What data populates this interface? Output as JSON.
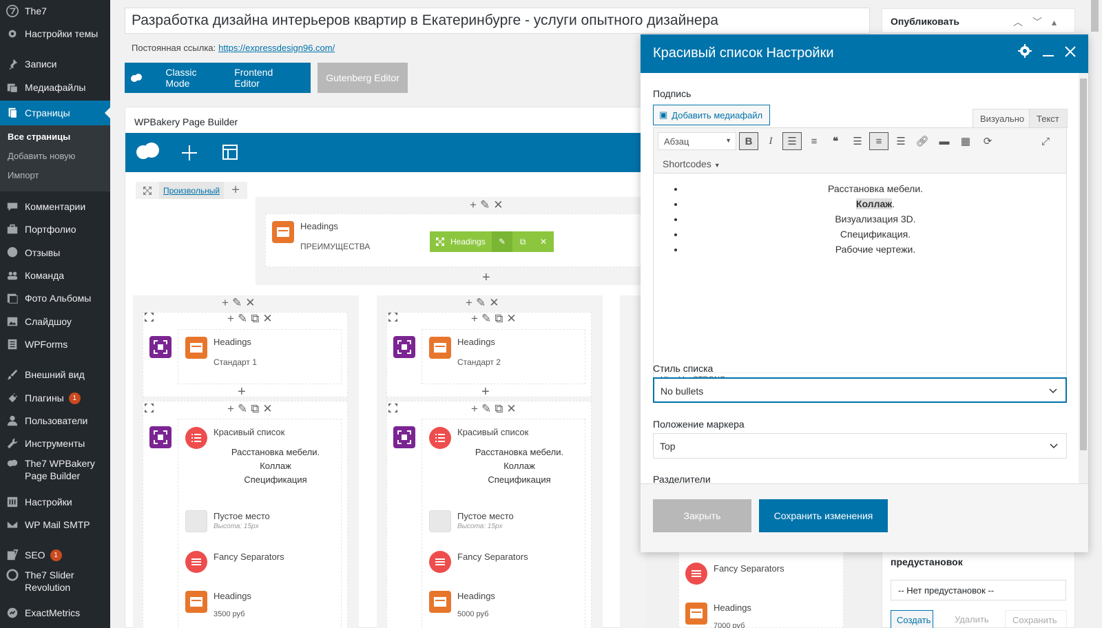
{
  "sidebar": {
    "items": [
      {
        "label": "The7",
        "icon": "the7-icon"
      },
      {
        "label": "Настройки темы",
        "icon": "gear-icon"
      },
      {
        "label": "Записи",
        "icon": "pin-icon"
      },
      {
        "label": "Медиафайлы",
        "icon": "media-icon"
      },
      {
        "label": "Страницы",
        "icon": "pages-icon"
      },
      {
        "label": "Комментарии",
        "icon": "comment-icon"
      },
      {
        "label": "Портфолио",
        "icon": "portfolio-icon"
      },
      {
        "label": "Отзывы",
        "icon": "testimonial-icon"
      },
      {
        "label": "Команда",
        "icon": "team-icon"
      },
      {
        "label": "Фото Альбомы",
        "icon": "album-icon"
      },
      {
        "label": "Слайдшоу",
        "icon": "slideshow-icon"
      },
      {
        "label": "WPForms",
        "icon": "forms-icon"
      },
      {
        "label": "Внешний вид",
        "icon": "brush-icon"
      },
      {
        "label": "Плагины",
        "icon": "plugin-icon",
        "badge": "1"
      },
      {
        "label": "Пользователи",
        "icon": "user-icon"
      },
      {
        "label": "Инструменты",
        "icon": "wrench-icon"
      },
      {
        "label": "The7 WPBakery",
        "label2": "Page Builder",
        "icon": "cloud-icon"
      },
      {
        "label": "Настройки",
        "icon": "settings-icon"
      },
      {
        "label": "WP Mail SMTP",
        "icon": "mail-icon"
      },
      {
        "label": "SEO",
        "icon": "yoast-icon",
        "badge": "1"
      },
      {
        "label": "The7 Slider",
        "label2": "Revolution",
        "icon": "slider-icon"
      },
      {
        "label": "ExactMetrics",
        "icon": "metrics-icon"
      }
    ],
    "submenu": [
      "Все страницы",
      "Добавить новую",
      "Импорт"
    ]
  },
  "editor": {
    "title": "Разработка дизайна интерьеров квартир в Екатеринбурге - услуги опытного дизайнера",
    "permalink_label": "Постоянная ссылка:",
    "permalink_url": "https://expressdesign96.com/",
    "modes": [
      "Classic Mode",
      "Frontend Editor"
    ],
    "gutenberg": "Gutenberg Editor"
  },
  "wpb": {
    "header": "WPBakery Page Builder",
    "row_label": "Произвольный",
    "top_element": {
      "title": "Headings",
      "sub": "ПРЕИМУЩЕСТВА"
    },
    "green_bar_label": "Headings",
    "columns": [
      {
        "heading_title": "Headings",
        "heading_sub": "Стандарт 1",
        "list_title": "Красивый список",
        "list_items": [
          "Расстановка мебели.",
          "Коллаж",
          "Спецификация"
        ],
        "spacer": "Пустое место",
        "spacer_meta": "Высота: 15px",
        "sep": "Fancy Separators",
        "heading2": "Headings",
        "price": "3500 руб"
      },
      {
        "heading_title": "Headings",
        "heading_sub": "Стандарт 2",
        "list_title": "Красивый список",
        "list_items": [
          "Расстановка мебели.",
          "Коллаж",
          "Спецификация"
        ],
        "spacer": "Пустое место",
        "spacer_meta": "Высота: 15px",
        "sep": "Fancy Separators",
        "heading2": "Headings",
        "price": "5000 руб"
      },
      {
        "sep": "Fancy Separators",
        "heading2": "Headings",
        "price": "7000 руб"
      }
    ]
  },
  "right": {
    "publish": "Опубликовать",
    "presets_title": "предустановок",
    "presets_select": "-- Нет предустановок --",
    "btn_create": "Создать",
    "btn_delete": "Удалить",
    "btn_save": "Сохранить"
  },
  "modal": {
    "title": "Красивый список Настройки",
    "caption_label": "Подпись",
    "add_media": "Добавить медиафайл",
    "tab_visual": "Визуально",
    "tab_text": "Текст",
    "format": "Абзац",
    "shortcodes": "Shortcodes",
    "content": [
      "Расстановка мебели.",
      "Коллаж",
      "Визуализация 3D.",
      "Спецификация.",
      "Рабочие чертежи."
    ],
    "path": "UL » LI » STRONG",
    "list_style_label": "Стиль списка",
    "list_style_value": "No bullets",
    "marker_label": "Положение маркера",
    "marker_value": "Top",
    "separators_label": "Разделители",
    "btn_close": "Закрыть",
    "btn_save": "Сохранить изменения"
  },
  "colors": {
    "accent": "#0073aa",
    "sidebar": "#23282d",
    "green": "#8cc63f",
    "orange": "#e7762c",
    "purple": "#7a2592",
    "red": "#ee4d4d"
  }
}
